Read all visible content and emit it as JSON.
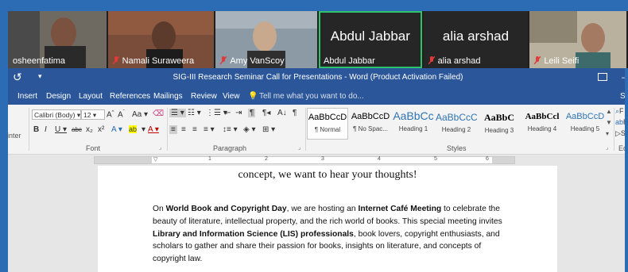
{
  "participants": [
    {
      "name": "osheenfatima",
      "muted": false,
      "type": "video",
      "bg": "#6e6a62"
    },
    {
      "name": "Namali Suraweera",
      "muted": true,
      "type": "video",
      "bg": "#7a4d3a"
    },
    {
      "name": "Amy VanScoy",
      "muted": true,
      "type": "video",
      "bg": "#8c9aa6"
    },
    {
      "name": "Abdul Jabbar",
      "muted": false,
      "type": "name",
      "active": true
    },
    {
      "name": "alia arshad",
      "muted": true,
      "type": "name"
    },
    {
      "name": "Leili Seifi",
      "muted": true,
      "type": "video",
      "bg": "#b9b19e"
    }
  ],
  "word": {
    "title": "SIG-III Research Seminar Call for Presentations - Word (Product Activation Failed)",
    "tabs": [
      "Insert",
      "Design",
      "Layout",
      "References",
      "Mailings",
      "Review",
      "View"
    ],
    "tell_me": "Tell me what you want to do...",
    "font_name": "Calibri (Body)",
    "font_size": "12",
    "groups": {
      "font": "Font",
      "paragraph": "Paragraph",
      "styles": "Styles"
    },
    "left_cut": "inter",
    "styles": [
      {
        "sample": "AaBbCcD",
        "name": "¶ Normal",
        "color": "#000000"
      },
      {
        "sample": "AaBbCcD",
        "name": "¶ No Spac...",
        "color": "#000000"
      },
      {
        "sample": "AaBbCc",
        "name": "Heading 1",
        "color": "#2e74b5"
      },
      {
        "sample": "AaBbCcC",
        "name": "Heading 2",
        "color": "#2e74b5"
      },
      {
        "sample": "AaBbC",
        "name": "Heading 3",
        "color": "#1f1f1f"
      },
      {
        "sample": "AaBbCcl",
        "name": "Heading 4",
        "color": "#1f1f1f"
      },
      {
        "sample": "AaBbCcD",
        "name": "Heading 5",
        "color": "#2e74b5"
      }
    ],
    "ruler_numbers": [
      "1",
      "2",
      "3",
      "4",
      "5",
      "6"
    ],
    "right_cut": {
      "edit1": "F",
      "edit2": "R",
      "edit3": "S",
      "group": "Ed"
    }
  },
  "document": {
    "lead_line": "concept, we want to hear your thoughts!",
    "para": [
      {
        "t": "On ",
        "b": false
      },
      {
        "t": "World Book and Copyright Day",
        "b": true
      },
      {
        "t": ", we are hosting an ",
        "b": false
      },
      {
        "t": "Internet Café Meeting",
        "b": true
      },
      {
        "t": " to celebrate the beauty of literature, intellectual property, and the rich world of books. This special meeting invites ",
        "b": false
      },
      {
        "t": "Library and Information Science (LIS) professionals",
        "b": true
      },
      {
        "t": ", book lovers, copyright enthusiasts, and scholars to gather and share their passion for books, insights on literature, and concepts of copyright law.",
        "b": false
      }
    ]
  }
}
